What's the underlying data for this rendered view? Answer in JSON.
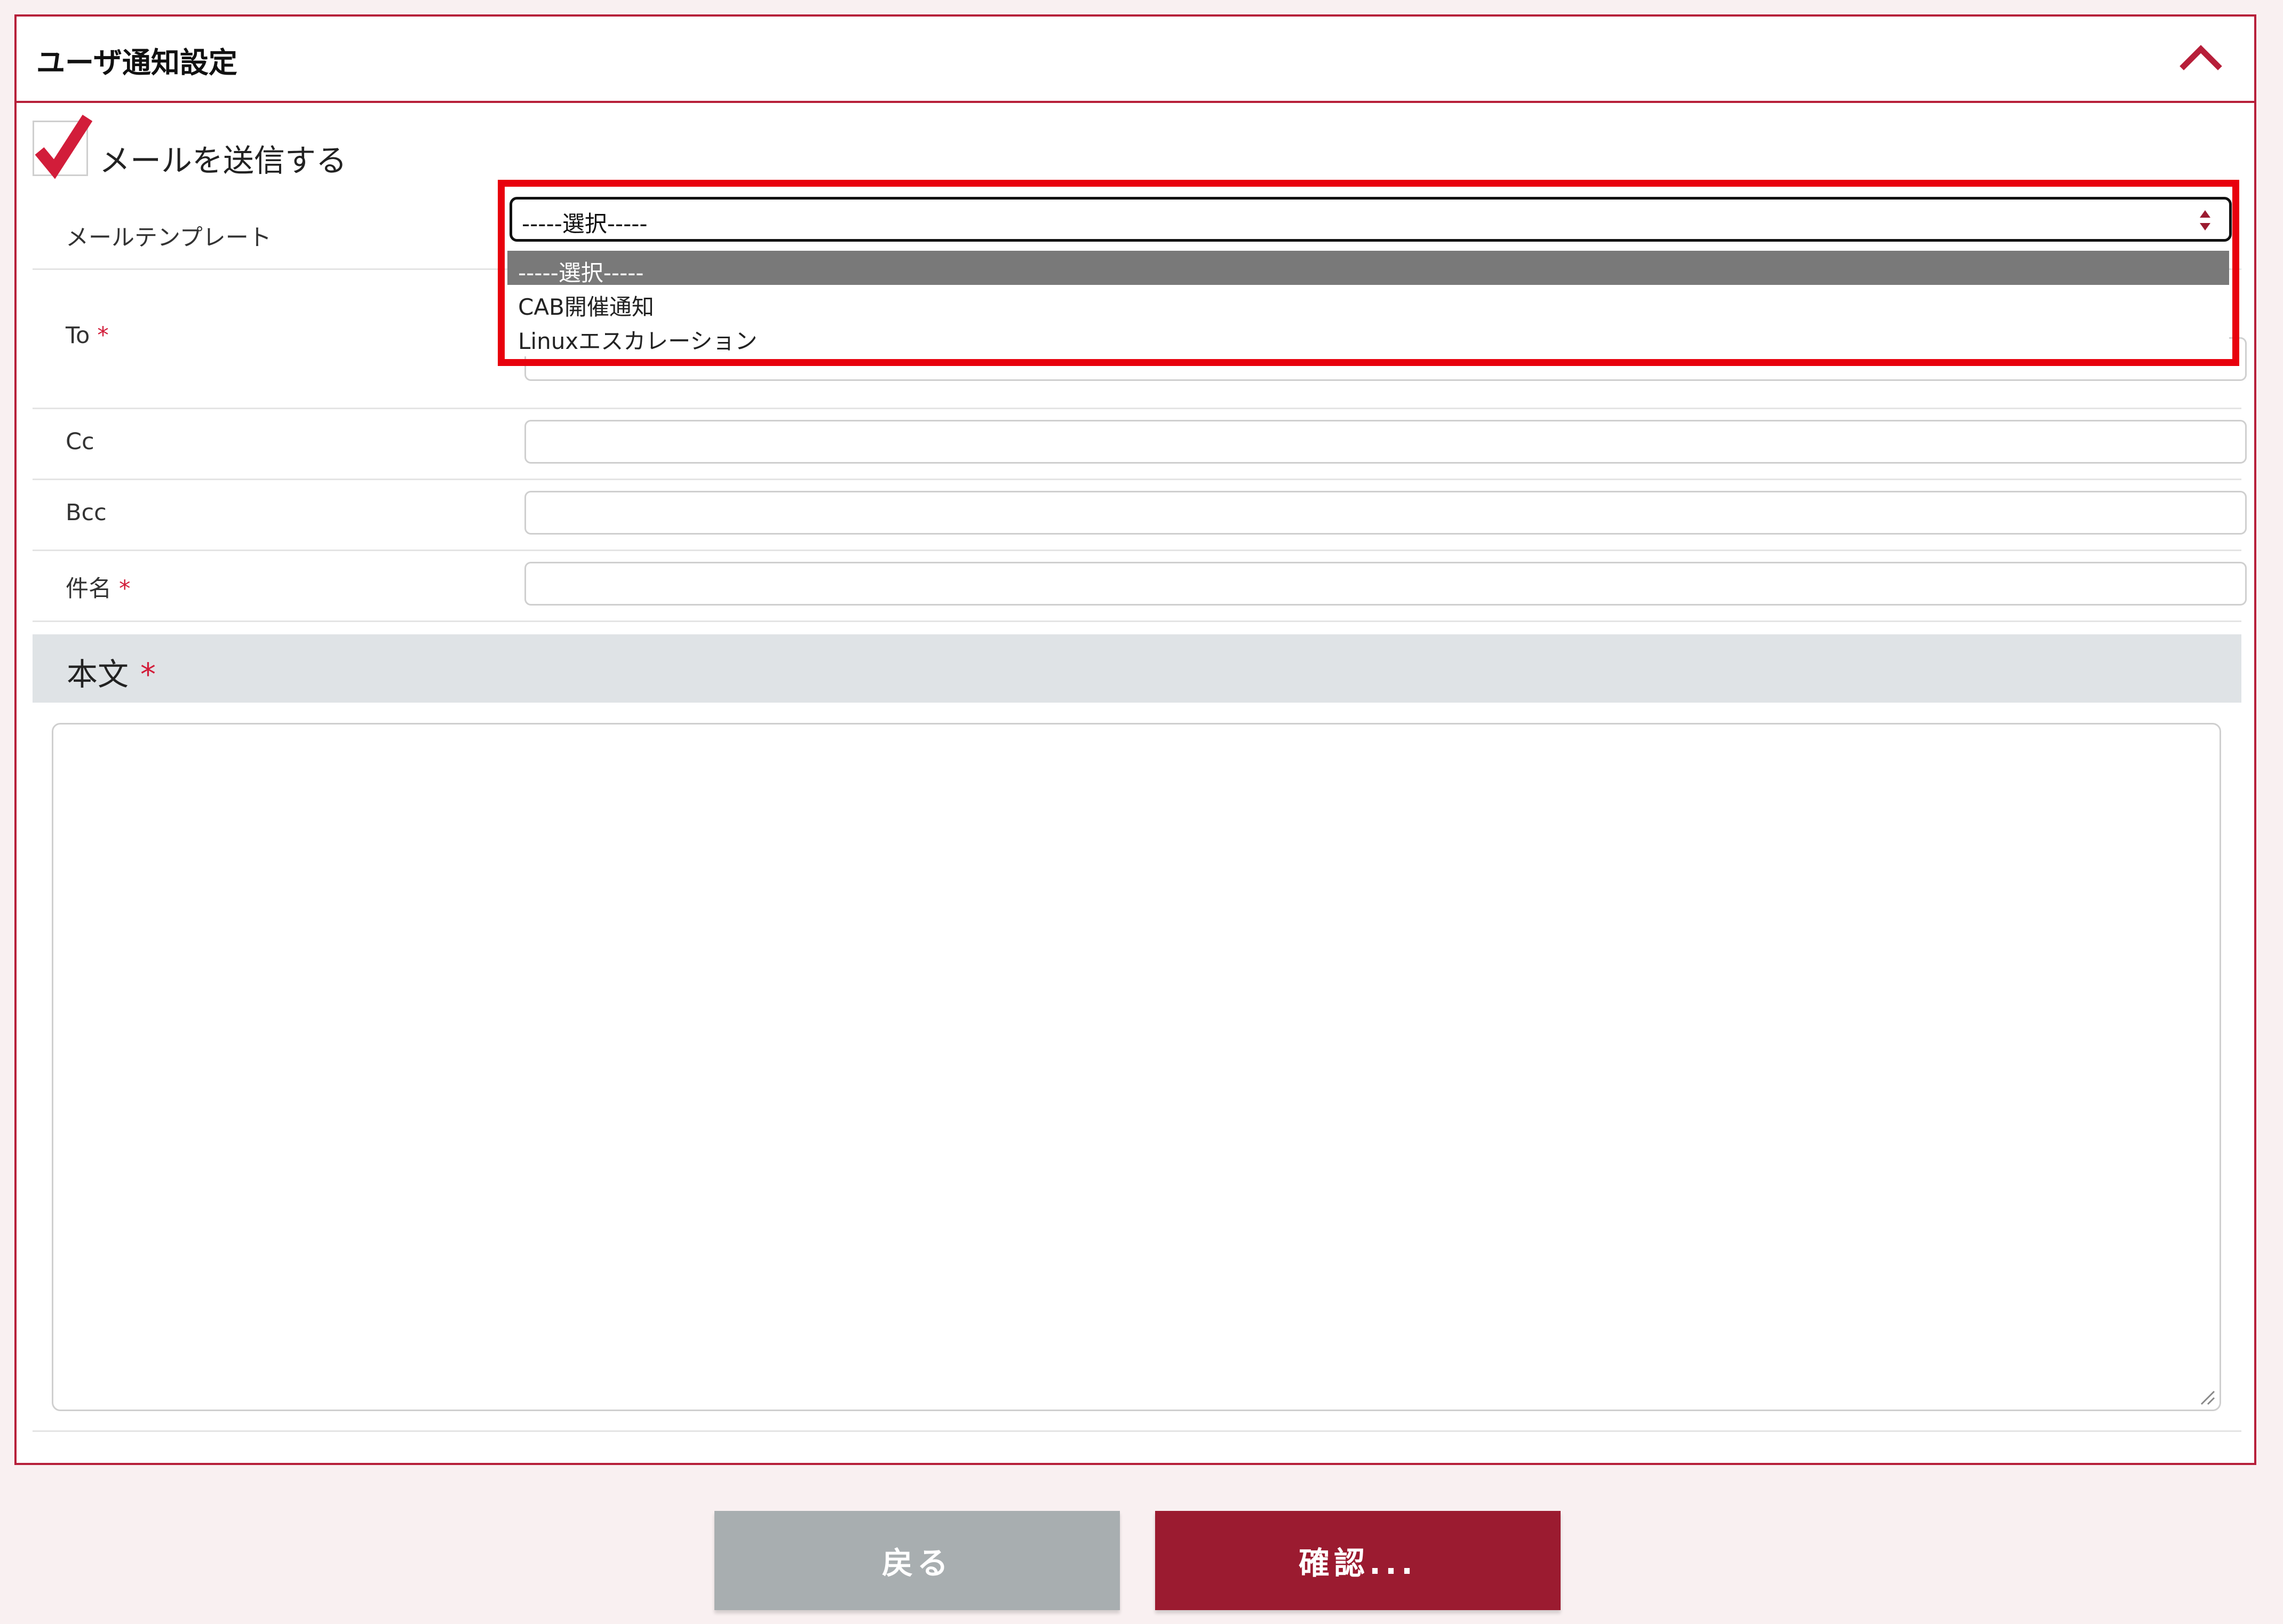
{
  "panel": {
    "title": "ユーザ通知設定",
    "collapse_icon": "chevron-up-icon"
  },
  "send_mail": {
    "label": "メールを送信する",
    "checked": true
  },
  "template": {
    "label": "メールテンプレート",
    "selected": "-----選択-----",
    "options": [
      "-----選択-----",
      "CAB開催通知",
      "Linuxエスカレーション"
    ]
  },
  "fields": {
    "to": {
      "label": "To",
      "required_mark": "*",
      "value": ""
    },
    "cc": {
      "label": "Cc",
      "value": ""
    },
    "bcc": {
      "label": "Bcc",
      "value": ""
    },
    "subject": {
      "label": "件名",
      "required_mark": "*",
      "value": ""
    }
  },
  "body": {
    "label": "本文",
    "required_mark": "*",
    "value": ""
  },
  "buttons": {
    "back": "戻る",
    "confirm": "確認..."
  },
  "colors": {
    "accent": "#b71f3a",
    "highlight": "#e8000d",
    "confirm_button": "#9b1b30",
    "back_button": "#a8aeb0"
  }
}
